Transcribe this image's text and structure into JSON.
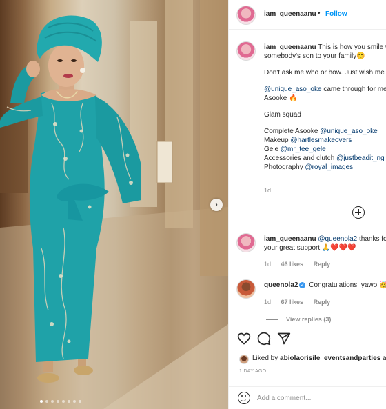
{
  "post": {
    "username": "iam_queenaanu",
    "separator": "•",
    "follow_label": "Follow",
    "carousel_next": "›",
    "carousel_count": 8,
    "carousel_active_index": 0
  },
  "caption": {
    "username": "iam_queenaanu",
    "lines": [
      "This is how you smile when you find",
      "somebody's son to your family😊",
      "",
      "Don't ask me who or how. Just wish me well",
      "",
      "@unique_aso_oke came through for me in",
      "Asooke 🔥",
      "",
      "Glam squad",
      "",
      "Complete Asooke @unique_aso_oke",
      "Makeup @hartlesmakeovers",
      "Gele @mr_tee_gele",
      "Accessories and clutch @justbeadit_ng",
      "Photography @royal_images"
    ],
    "time": "1d"
  },
  "comments": [
    {
      "username": "iam_queenaanu",
      "mention": "@queenola2",
      "text": "thanks for",
      "text2": "your great support.🙏❤️❤️❤️",
      "time": "1d",
      "likes": "46 likes",
      "reply": "Reply"
    },
    {
      "username": "queenola2",
      "verified": "✓",
      "text": "Congratulations Iyawo 🥳",
      "time": "1d",
      "likes": "67 likes",
      "reply": "Reply",
      "view_replies": "View replies (3)"
    }
  ],
  "actions": {
    "liked_prefix": "Liked by",
    "liked_user": "abiolaorisile_eventsandparties",
    "liked_suffix": "and",
    "post_time": "1 DAY AGO"
  },
  "add_comment": {
    "placeholder": "Add a comment..."
  },
  "colors": {
    "accent": "#0095f6",
    "mention": "#00376b",
    "muted": "#8e8e8e",
    "heart": "#ed4956",
    "dress": "#1fa2a8"
  }
}
